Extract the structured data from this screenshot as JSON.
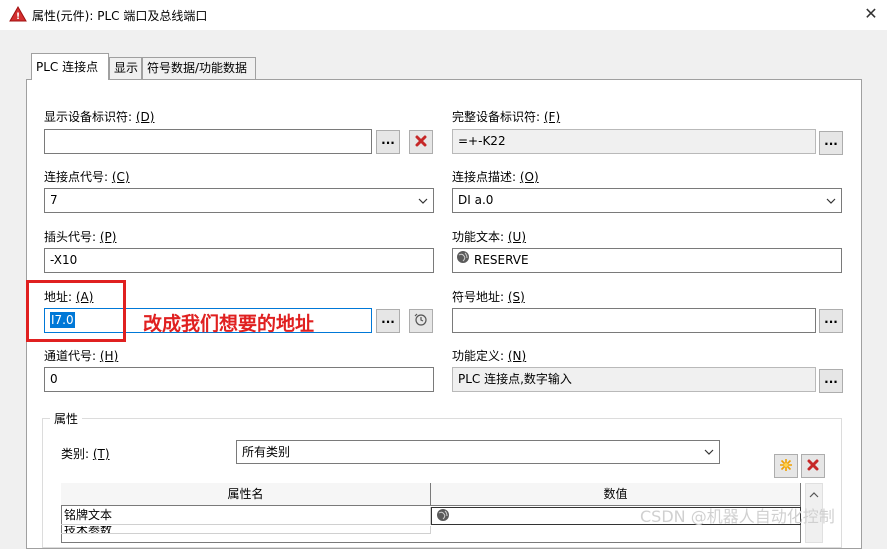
{
  "window": {
    "title": "属性(元件): PLC 端口及总线端口",
    "close_glyph": "✕"
  },
  "tabs": [
    {
      "label": "PLC 连接点",
      "active": true
    },
    {
      "label": "显示",
      "active": false
    },
    {
      "label": "符号数据/功能数据",
      "active": false
    }
  ],
  "fields": {
    "display_device_tag": {
      "label": "显示设备标识符:",
      "hotkey": "(D)",
      "value": ""
    },
    "full_device_tag": {
      "label": "完整设备标识符:",
      "hotkey": "(F)",
      "value": "=+-K22"
    },
    "connection_point_code": {
      "label": "连接点代号:",
      "hotkey": "(C)",
      "value": "7"
    },
    "connection_point_desc": {
      "label": "连接点描述:",
      "hotkey": "(O)",
      "value": "DI a.0"
    },
    "plug_code": {
      "label": "插头代号:",
      "hotkey": "(P)",
      "value": "-X10"
    },
    "function_text": {
      "label": "功能文本:",
      "hotkey": "(U)",
      "value": "RESERVE"
    },
    "address": {
      "label": "地址:",
      "hotkey": "(A)",
      "value": "I7.0"
    },
    "symbolic_address": {
      "label": "符号地址:",
      "hotkey": "(S)",
      "value": ""
    },
    "channel_code": {
      "label": "通道代号:",
      "hotkey": "(H)",
      "value": "0"
    },
    "function_definition": {
      "label": "功能定义:",
      "hotkey": "(N)",
      "value": "PLC 连接点,数字输入"
    }
  },
  "buttons": {
    "dots": "..."
  },
  "annotation": {
    "text": "改成我们想要的地址",
    "color": "#e02020"
  },
  "properties": {
    "group_title": "属性",
    "category_label": "类别:",
    "category_hotkey": "(T)",
    "category_value": "所有类别",
    "columns": [
      "属性名",
      "数值"
    ],
    "rows": [
      {
        "name": "铭牌文本",
        "value": ""
      },
      {
        "name": "技术参数",
        "value": ""
      }
    ]
  },
  "watermark": "CSDN @机器人自动化控制",
  "icons": {
    "app": "eplan-warning-icon",
    "delete": "red-x-icon",
    "add": "new-star-icon",
    "globe": "globe-icon",
    "address_assist": "address-assist-icon"
  },
  "colors": {
    "accent": "#0078d7",
    "delete": "#c62828",
    "annotation": "#e02020"
  }
}
